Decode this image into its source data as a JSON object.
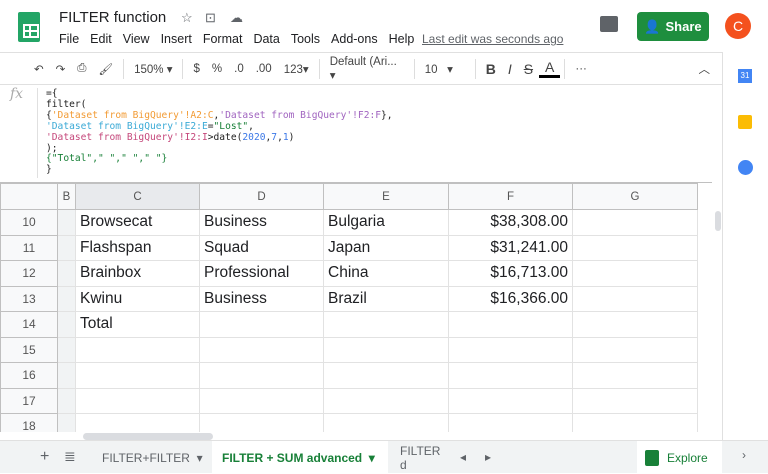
{
  "app": {
    "title": "FILTER function",
    "last_edit": "Last edit was seconds ago",
    "share_label": "Share",
    "avatar_initial": "C"
  },
  "menu": [
    "File",
    "Edit",
    "View",
    "Insert",
    "Format",
    "Data",
    "Tools",
    "Add-ons",
    "Help"
  ],
  "toolbar": {
    "zoom": "150%",
    "currency": "$",
    "percent": "%",
    "dec_less": ".0",
    "dec_more": ".00",
    "format": "123",
    "font": "Default (Ari...",
    "font_size": "10",
    "bold": "B",
    "italic": "I",
    "strike": "S",
    "text_color": "A",
    "more": "···"
  },
  "formula": {
    "fx": "fx",
    "lines": [
      "={",
      "filter(",
      "{'Dataset from BigQuery'!A2:C,'Dataset from BigQuery'!F2:F},",
      "'Dataset from BigQuery'!E2:E=\"Lost\",",
      "'Dataset from BigQuery'!I2:I>date(2020,7,1)",
      ");",
      "{\"Total\",\" \",\" \",\" \"}",
      "}"
    ]
  },
  "columns": [
    "B",
    "C",
    "D",
    "E",
    "F",
    "G"
  ],
  "rows": [
    {
      "n": "10",
      "c": "Browsecat",
      "d": "Business",
      "e": "Bulgaria",
      "f": "$38,308.00"
    },
    {
      "n": "11",
      "c": "Flashspan",
      "d": "Squad",
      "e": "Japan",
      "f": "$31,241.00"
    },
    {
      "n": "12",
      "c": "Brainbox",
      "d": "Professional",
      "e": "China",
      "f": "$16,713.00"
    },
    {
      "n": "13",
      "c": "Kwinu",
      "d": "Business",
      "e": "Brazil",
      "f": "$16,366.00"
    },
    {
      "n": "14",
      "c": "Total",
      "d": "",
      "e": "",
      "f": ""
    },
    {
      "n": "15",
      "c": "",
      "d": "",
      "e": "",
      "f": ""
    },
    {
      "n": "16",
      "c": "",
      "d": "",
      "e": "",
      "f": ""
    },
    {
      "n": "17",
      "c": "",
      "d": "",
      "e": "",
      "f": ""
    },
    {
      "n": "18",
      "c": "",
      "d": "",
      "e": "",
      "f": ""
    }
  ],
  "sheets": [
    "FILTER+FILTER",
    "FILTER + SUM advanced",
    "FILTER d"
  ],
  "explore_label": "Explore"
}
